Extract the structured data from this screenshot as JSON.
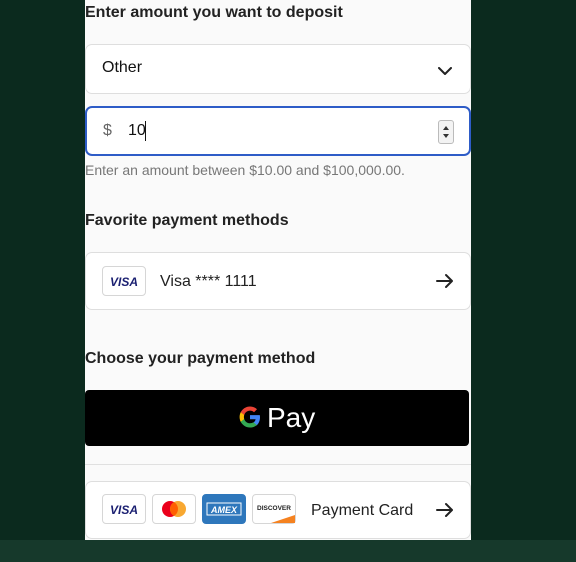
{
  "deposit": {
    "title": "Enter amount you want to deposit",
    "select_value": "Other",
    "currency_symbol": "$",
    "amount_value": "10",
    "hint": "Enter an amount between $10.00 and $100,000.00."
  },
  "favorites": {
    "title": "Favorite payment methods",
    "items": [
      {
        "brand": "VISA",
        "label": "Visa **** 1111",
        "icon": "arrow-right-icon"
      }
    ]
  },
  "payment_methods": {
    "title": "Choose your payment method",
    "google_pay_label": "Pay",
    "card_option": {
      "label": "Payment Card",
      "brands": [
        "VISA",
        "Mastercard",
        "AMEX",
        "DISCOVER"
      ],
      "icon": "arrow-right-icon"
    }
  },
  "colors": {
    "background": "#0b2a1e",
    "focus_border": "#2e5cc7",
    "visa_blue": "#1a1f71"
  }
}
